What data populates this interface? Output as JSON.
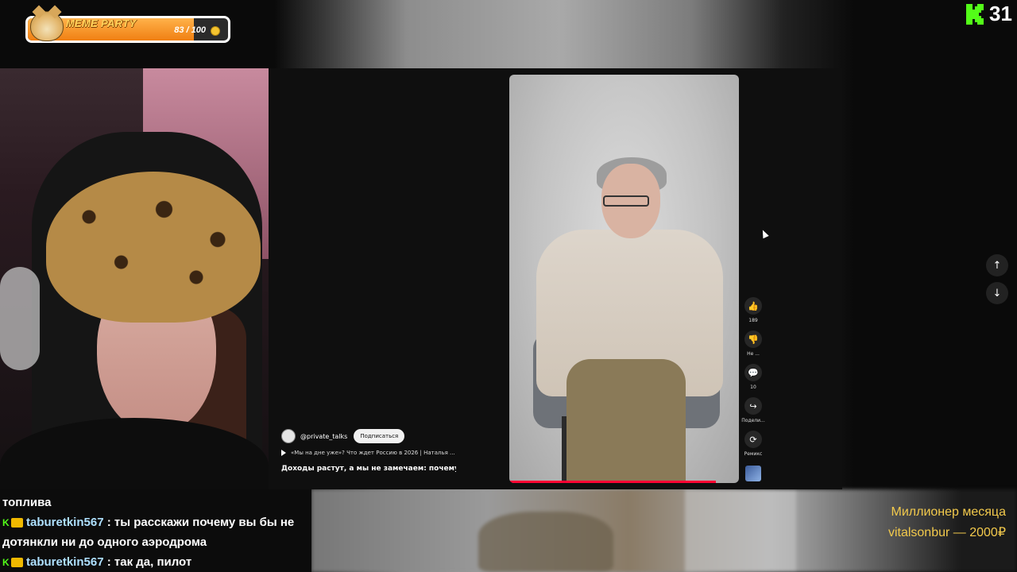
{
  "widget": {
    "title": "MEME PARTY",
    "count": "83 / 100",
    "progress": 0.83
  },
  "kick": {
    "viewers": "31"
  },
  "video": {
    "channel": "@private_talks",
    "subscribe_label": "Подписаться",
    "linked_video": "«Мы на дне уже»? Что ждет Россию в 2026 | Наталья ...",
    "title": "Доходы растут, а мы не замечаем: почему? ...",
    "progress": 0.9,
    "actions": {
      "likes": "189",
      "dislike": "Не ...",
      "comments": "10",
      "share": "Подели...",
      "remix": "Ремикс"
    }
  },
  "chat": {
    "line0": "топлива",
    "msg1_user": "taburetkin567",
    "msg1_text": ": ты расскажи почему вы бы не",
    "msg1_cont": "дотянкли ни до одного аэродрома",
    "msg2_user": "taburetkin567",
    "msg2_text": ": так да, пилот",
    "badge_k": "K"
  },
  "top_donor": {
    "label": "Миллионер месяца",
    "line": "vitalsonbur — 2000₽"
  },
  "colors": {
    "kick_green": "#53fc18",
    "donor_gold": "#f2c94c",
    "progress_red": "#ff0033"
  }
}
